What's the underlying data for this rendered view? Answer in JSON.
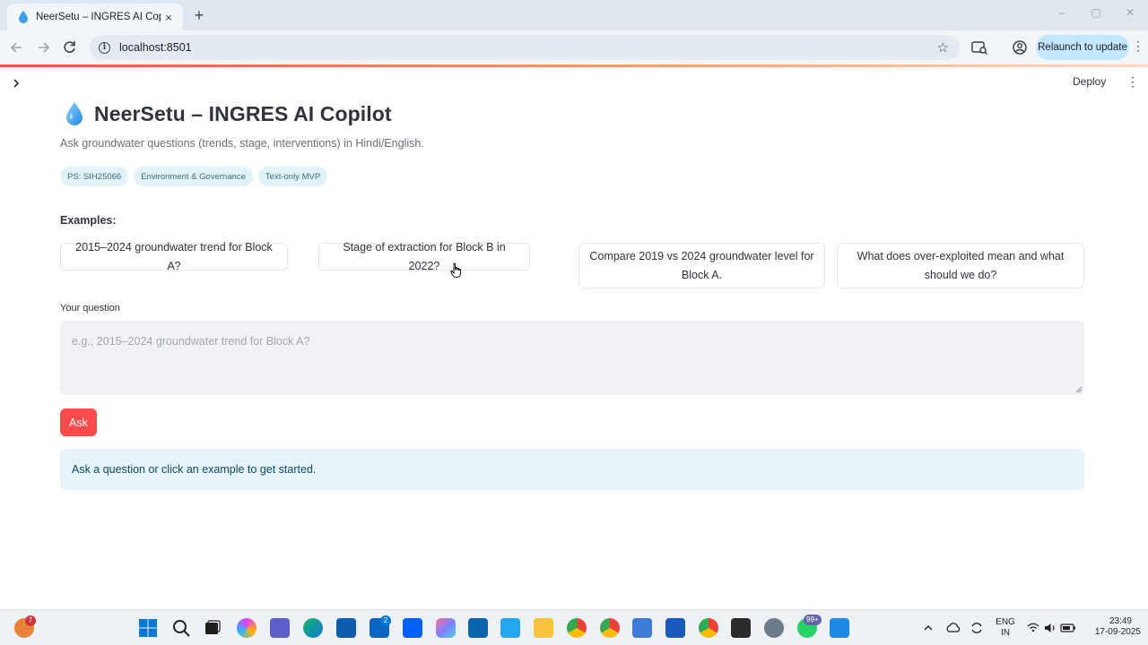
{
  "browser": {
    "tab_title": "NeerSetu – INGRES AI Copilot",
    "tab_close": "×",
    "new_tab": "+",
    "url": "localhost:8501",
    "relaunch_label": "Relaunch to update",
    "window_controls": [
      "–",
      "▢",
      "✕"
    ]
  },
  "app": {
    "sidebar_toggle": "›",
    "deploy_label": "Deploy",
    "menu_glyph": "⋮",
    "title": "NeerSetu – INGRES AI Copilot",
    "subtitle": "Ask groundwater questions (trends, stage, interventions) in Hindi/English.",
    "badges": [
      "PS: SIH25066",
      "Environment & Governance",
      "Text-only MVP"
    ],
    "examples_label": "Examples:",
    "examples": [
      "2015–2024 groundwater trend for Block A?",
      "Stage of extraction for Block B in 2022?",
      "Compare 2019 vs 2024 groundwater level for Block A.",
      "What does over-exploited mean and what should we do?"
    ],
    "question_label": "Your question",
    "question_placeholder": "e.g., 2015–2024 groundwater trend for Block A?",
    "question_value": "",
    "ask_label": "Ask",
    "info_message": "Ask a question or click an example to get started."
  },
  "taskbar": {
    "widget_badge": "7",
    "outlook_badge": "2",
    "whatsapp_badge": "99+",
    "lang_top": "ENG",
    "lang_bottom": "IN",
    "time": "23:49",
    "date": "17-09-2025"
  },
  "colors": {
    "accent": "#ff4b4b",
    "info_bg": "#e6f4fa",
    "badge_bg": "#e2f3f8",
    "relaunch_bg": "#c2e7ff"
  }
}
